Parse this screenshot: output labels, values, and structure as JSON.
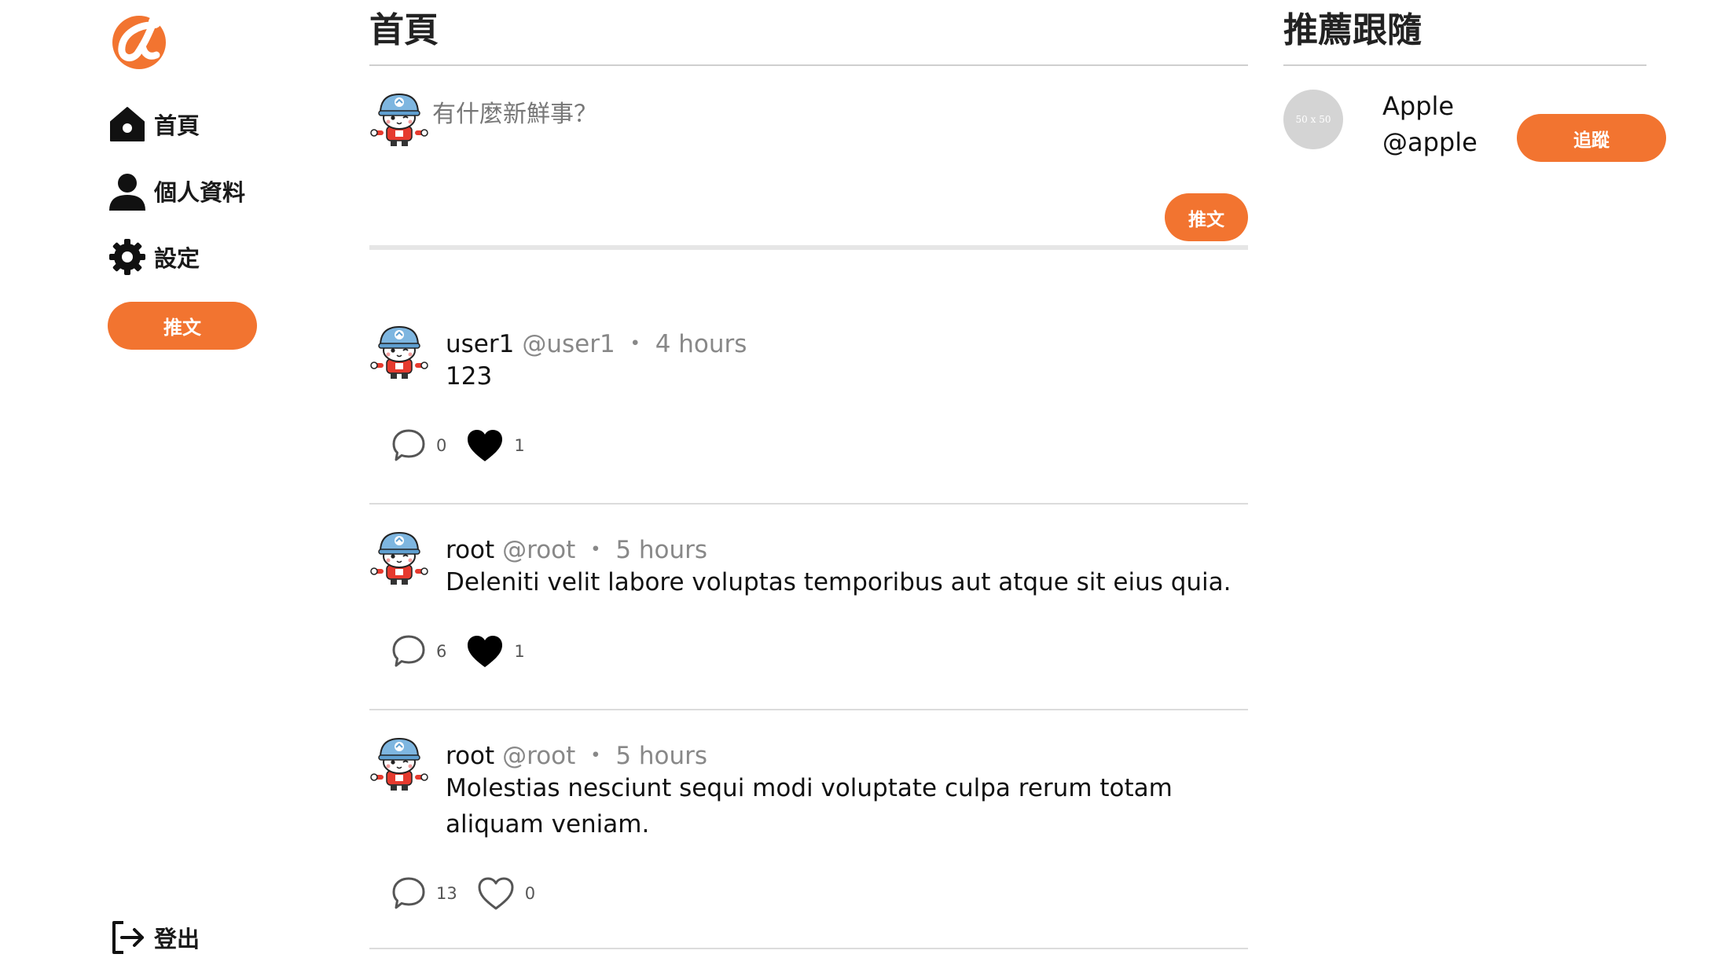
{
  "brand": {
    "accent": "#F27430"
  },
  "sidebar": {
    "logo_icon": "alpha-logo-icon",
    "items": [
      {
        "label": "首頁",
        "icon": "home-icon"
      },
      {
        "label": "個人資料",
        "icon": "user-icon"
      },
      {
        "label": "設定",
        "icon": "gear-icon"
      }
    ],
    "tweet_button": "推文",
    "logout": {
      "label": "登出",
      "icon": "logout-icon"
    }
  },
  "main": {
    "title": "首頁",
    "compose": {
      "placeholder": "有什麼新鮮事？",
      "submit": "推文"
    },
    "tweets": [
      {
        "name": "user1",
        "handle": "@user1",
        "dot": "・",
        "time": "4 hours",
        "text": "123",
        "replies": "0",
        "likes": "1",
        "liked": true
      },
      {
        "name": "root",
        "handle": "@root",
        "dot": "・",
        "time": "5 hours",
        "text": "Deleniti velit labore voluptas temporibus aut atque sit eius quia.",
        "replies": "6",
        "likes": "1",
        "liked": true
      },
      {
        "name": "root",
        "handle": "@root",
        "dot": "・",
        "time": "5 hours",
        "text": "Molestias nesciunt sequi modi voluptate culpa rerum totam aliquam veniam.",
        "replies": "13",
        "likes": "0",
        "liked": false
      }
    ]
  },
  "right": {
    "title": "推薦跟隨",
    "suggestions": [
      {
        "avatar_text": "50 x 50",
        "name": "Apple",
        "handle": "@apple",
        "button": "追蹤"
      }
    ]
  }
}
